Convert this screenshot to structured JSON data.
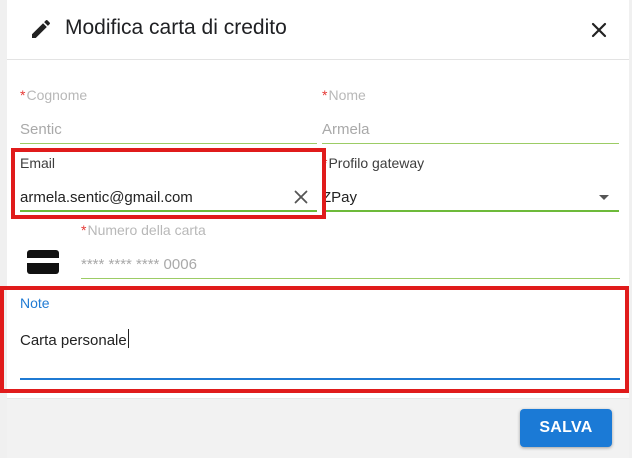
{
  "dialog": {
    "title": "Modifica carta di credito",
    "title_icon": "pencil-icon",
    "close_icon": "close-icon"
  },
  "form": {
    "cognome": {
      "label": "Cognome",
      "required": "*",
      "value": "Sentic"
    },
    "nome": {
      "label": "Nome",
      "required": "*",
      "value": "Armela"
    },
    "email": {
      "label": "Email",
      "value": "armela.sentic@gmail.com",
      "clear_icon": "clear-icon"
    },
    "profilo_gateway": {
      "label": "Profilo gateway",
      "required": "*",
      "value": "ZPay",
      "dropdown_icon": "chevron-down-icon"
    },
    "numero_carta": {
      "label": "Numero della carta",
      "required": "*",
      "value": "**** **** **** 0006",
      "icon": "credit-card-icon"
    },
    "note": {
      "label": "Note",
      "value": "Carta personale"
    }
  },
  "footer": {
    "save_label": "SALVA"
  },
  "colors": {
    "accent": "#1b7ad6",
    "required": "#e53935",
    "valid_underline": "#9ccc65",
    "highlight": "#e01b1b"
  }
}
